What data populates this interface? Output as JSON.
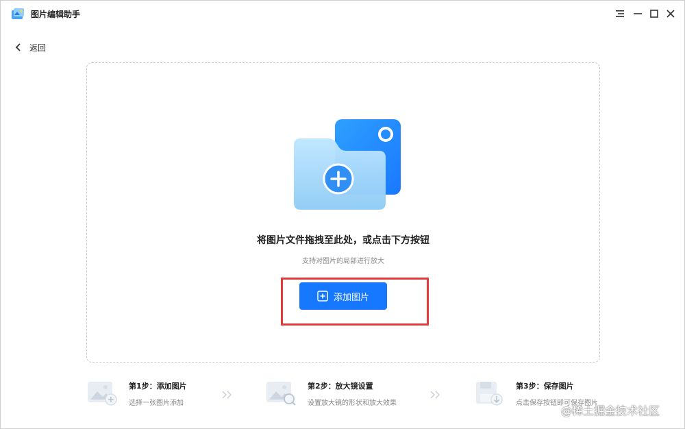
{
  "app": {
    "title": "图片编辑助手"
  },
  "nav": {
    "back_label": "返回"
  },
  "dropzone": {
    "title": "将图片文件拖拽至此处，或点击下方按钮",
    "subtitle": "支持对图片的局部进行放大",
    "add_button_label": "添加图片"
  },
  "steps": [
    {
      "title": "第1步：添加图片",
      "desc": "选择一张图片添加"
    },
    {
      "title": "第2步：放大镜设置",
      "desc": "设置放大镜的形状和放大效果"
    },
    {
      "title": "第3步：保存图片",
      "desc": "点击保存按钮即可保存图片"
    }
  ],
  "watermark": "@稀土掘金技术社区",
  "colors": {
    "accent": "#1677ff",
    "highlight": "#e03a3a"
  },
  "icons": [
    "app-logo-icon",
    "menu-icon",
    "minimize-icon",
    "maximize-icon",
    "close-icon",
    "back-chevron-icon",
    "folder-add-icon",
    "plus-square-icon",
    "add-image-icon",
    "magnifier-image-icon",
    "save-image-icon",
    "double-chevron-icon"
  ]
}
